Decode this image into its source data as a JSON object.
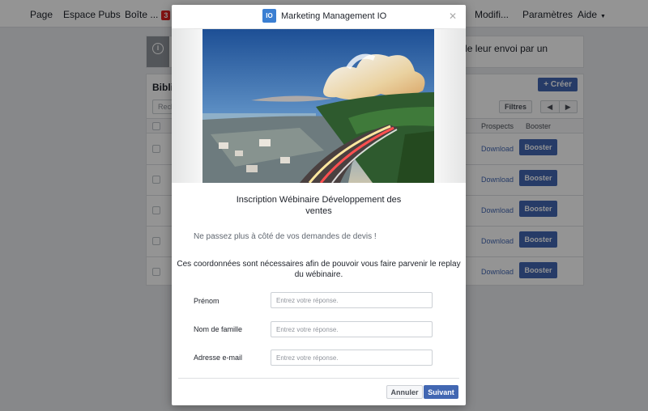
{
  "nav": {
    "items": [
      {
        "label": "Page"
      },
      {
        "label": "Espace Pubs"
      },
      {
        "label": "Boîte ..."
      },
      {
        "label": "Modifi..."
      },
      {
        "label": "Paramètres"
      },
      {
        "label": "Aide"
      }
    ],
    "inbox_badge": "3"
  },
  "notice": {
    "text": "heure de leur envoi par un"
  },
  "library": {
    "title": "Biblio",
    "create_label": "Créer",
    "search_placeholder": "Rech",
    "filters_label": "Filtres",
    "columns": {
      "prospects": "Prospects",
      "booster": "Booster"
    },
    "rows": [
      {
        "download": "Download",
        "boost": "Booster"
      },
      {
        "download": "Download",
        "boost": "Booster"
      },
      {
        "download": "Download",
        "boost": "Booster"
      },
      {
        "download": "Download",
        "boost": "Booster"
      },
      {
        "download": "Download",
        "boost": "Booster"
      }
    ]
  },
  "modal": {
    "logo_text": "IO",
    "title": "Marketing Management IO",
    "form_title": "Inscription Wébinaire Développement des ventes",
    "subtitle": "Ne passez plus à côté de vos demandes de devis !",
    "description": "Ces coordonnées sont nécessaires afin de pouvoir vous faire parvenir le replay du wébinaire.",
    "fields": [
      {
        "label": "Prénom",
        "placeholder": "Entrez votre réponse."
      },
      {
        "label": "Nom de famille",
        "placeholder": "Entrez votre réponse."
      },
      {
        "label": "Adresse e-mail",
        "placeholder": "Entrez votre réponse."
      }
    ],
    "cancel_label": "Annuler",
    "next_label": "Suivant"
  },
  "colors": {
    "accent": "#4267b2",
    "overlay": "#000000",
    "badge": "#e02020"
  }
}
